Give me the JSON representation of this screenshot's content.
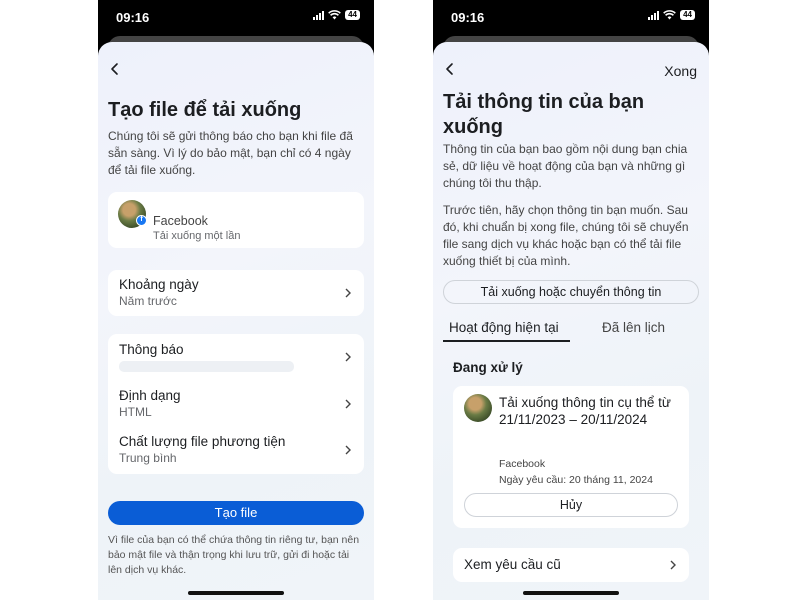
{
  "status_bar": {
    "time": "09:16",
    "battery": "44"
  },
  "left_screen": {
    "title": "Tạo file để tải xuống",
    "description": "Chúng tôi sẽ gửi thông báo cho bạn khi file đã sẵn sàng. Vì lý do bảo mật, bạn chỉ có 4 ngày để tải file xuống.",
    "account": {
      "name": "Facebook",
      "subtitle": "Tải xuống một lần"
    },
    "date_range": {
      "label": "Khoảng ngày",
      "value": "Năm trước"
    },
    "notification": {
      "label": "Thông báo"
    },
    "format": {
      "label": "Định dạng",
      "value": "HTML"
    },
    "media_quality": {
      "label": "Chất lượng file phương tiện",
      "value": "Trung bình"
    },
    "create_button": "Tạo file",
    "footer_note": "Vì file của bạn có thể chứa thông tin riêng tư, bạn nên bảo mật file và thận trọng khi lưu trữ, gửi đi hoặc tải lên dịch vụ khác."
  },
  "right_screen": {
    "done_label": "Xong",
    "title": "Tải thông tin của bạn xuống",
    "description_1": "Thông tin của bạn bao gồm nội dung bạn chia sẻ, dữ liệu về hoạt động của bạn và những gì chúng tôi thu thập.",
    "description_2": "Trước tiên, hãy chọn thông tin bạn muốn. Sau đó, khi chuẩn bị xong file, chúng tôi sẽ chuyển file sang dịch vụ khác hoặc bạn có thể tải file xuống thiết bị của mình.",
    "transfer_button": "Tải xuống hoặc chuyển thông tin",
    "tabs": {
      "active": "Hoạt động hiện tại",
      "scheduled": "Đã lên lịch"
    },
    "processing_label": "Đang xử lý",
    "request": {
      "title": "Tải xuống thông tin cụ thể từ 21/11/2023 – 20/11/2024",
      "account": "Facebook",
      "requested_date": "Ngày yêu cầu: 20 tháng 11, 2024",
      "cancel_button": "Hủy"
    },
    "old_requests": "Xem yêu cầu cũ"
  },
  "colors": {
    "primary": "#0a5dd6",
    "facebook_blue": "#1877f2",
    "sheet_bg": "#eef1fb"
  }
}
